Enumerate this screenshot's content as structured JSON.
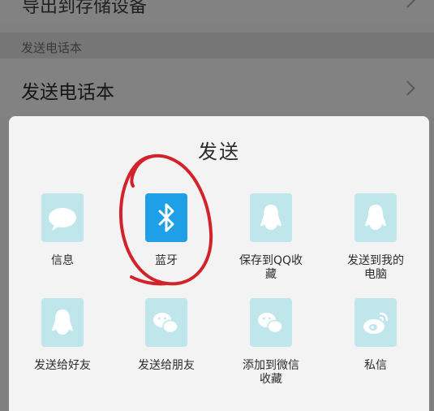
{
  "settings": {
    "top_row_label": "导出到存储设备",
    "section_header": "发送电话本",
    "phonebook_row_label": "发送电话本"
  },
  "share_sheet": {
    "title": "发送",
    "items": [
      {
        "label": "信息",
        "icon": "message-bubble-icon"
      },
      {
        "label": "蓝牙",
        "icon": "bluetooth-icon"
      },
      {
        "label": "保存到QQ收藏",
        "icon": "qq-penguin-icon"
      },
      {
        "label": "发送到我的电脑",
        "icon": "qq-penguin-icon"
      },
      {
        "label": "发送给好友",
        "icon": "qq-penguin-icon"
      },
      {
        "label": "发送给朋友",
        "icon": "wechat-icon"
      },
      {
        "label": "添加到微信收藏",
        "icon": "wechat-icon"
      },
      {
        "label": "私信",
        "icon": "weibo-icon"
      }
    ]
  },
  "colors": {
    "tile_bg": "#bfe6ea",
    "bluetooth_bg": "#1e9fe6",
    "annotation_red": "#d2232a"
  }
}
